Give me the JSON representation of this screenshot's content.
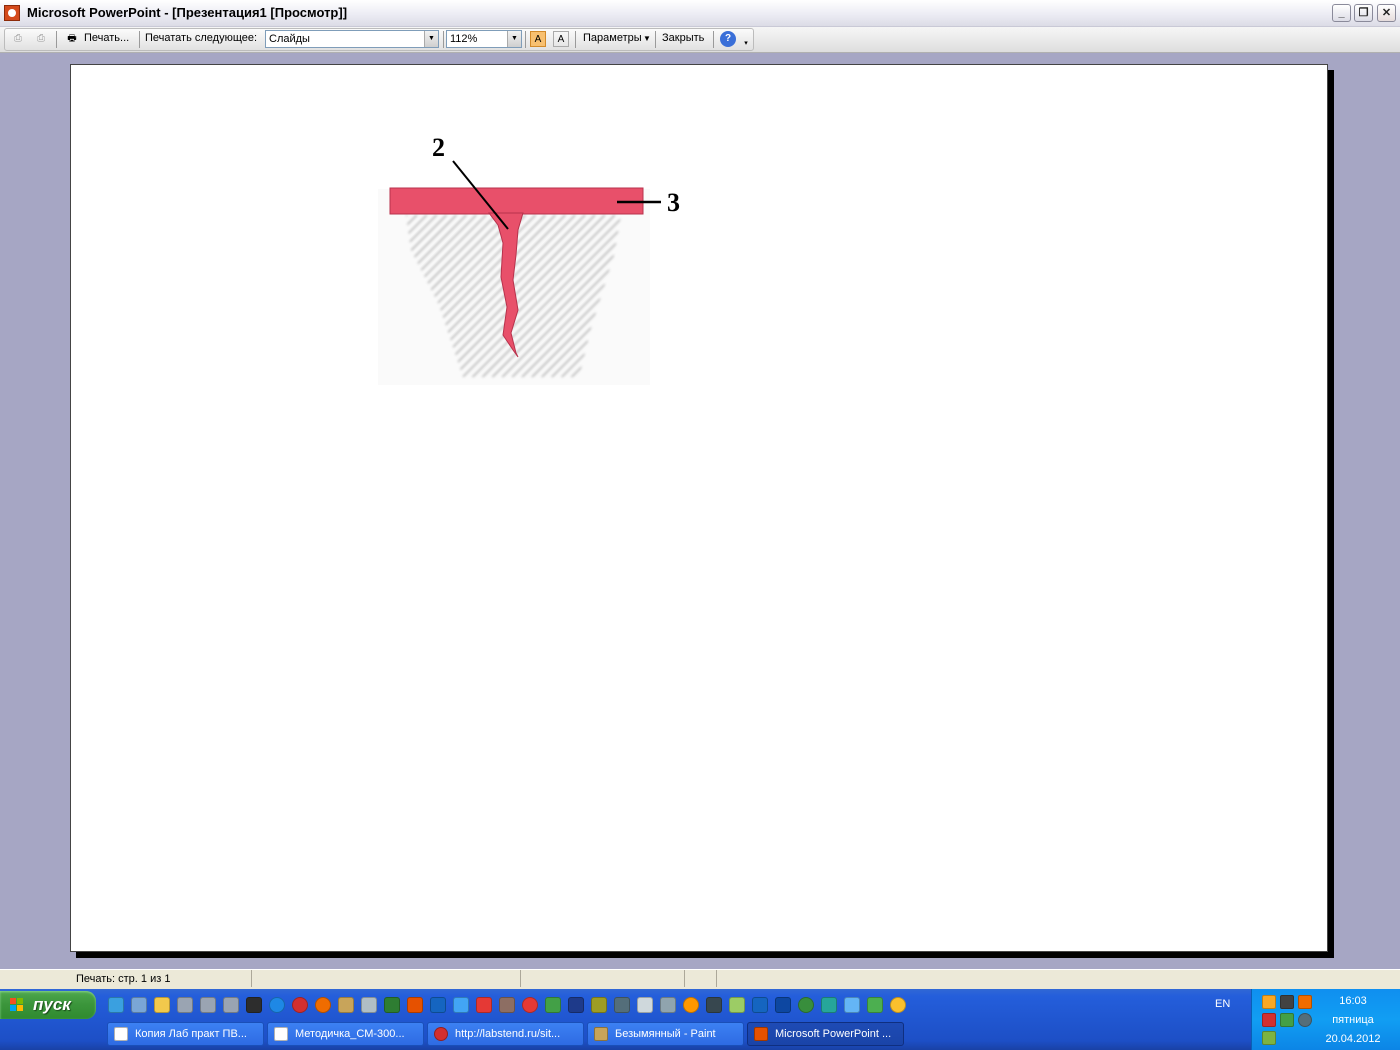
{
  "window": {
    "title": "Microsoft PowerPoint - [Презентация1 [Просмотр]]",
    "min_glyph": "_",
    "restore_glyph": "❐",
    "close_glyph": "✕"
  },
  "toolbar": {
    "print_label": "Печать...",
    "print_what_label": "Печатать следующее:",
    "print_what_value": "Слайды",
    "zoom_value": "112%",
    "params_label": "Параметры",
    "close_label": "Закрыть",
    "help_glyph": "?",
    "dropdown_glyph": "▼"
  },
  "slide": {
    "label_2": "2",
    "label_3": "3"
  },
  "status": {
    "page_info": "Печать: стр. 1 из 1"
  },
  "taskbar": {
    "start_label": "пуск",
    "lang": "EN",
    "tasks": [
      {
        "label": "Копия Лаб практ ПВ..."
      },
      {
        "label": "Методичка_СМ-300..."
      },
      {
        "label": "http://labstend.ru/sit..."
      },
      {
        "label": "Безымянный - Paint"
      },
      {
        "label": "Microsoft PowerPoint ..."
      }
    ],
    "clock": {
      "time": "16:03",
      "day": "пятница",
      "date": "20.04.2012"
    }
  },
  "colors": {
    "accent_pink": "#e8506a",
    "taskbar_blue": "#245edb",
    "start_green": "#3c963c"
  }
}
